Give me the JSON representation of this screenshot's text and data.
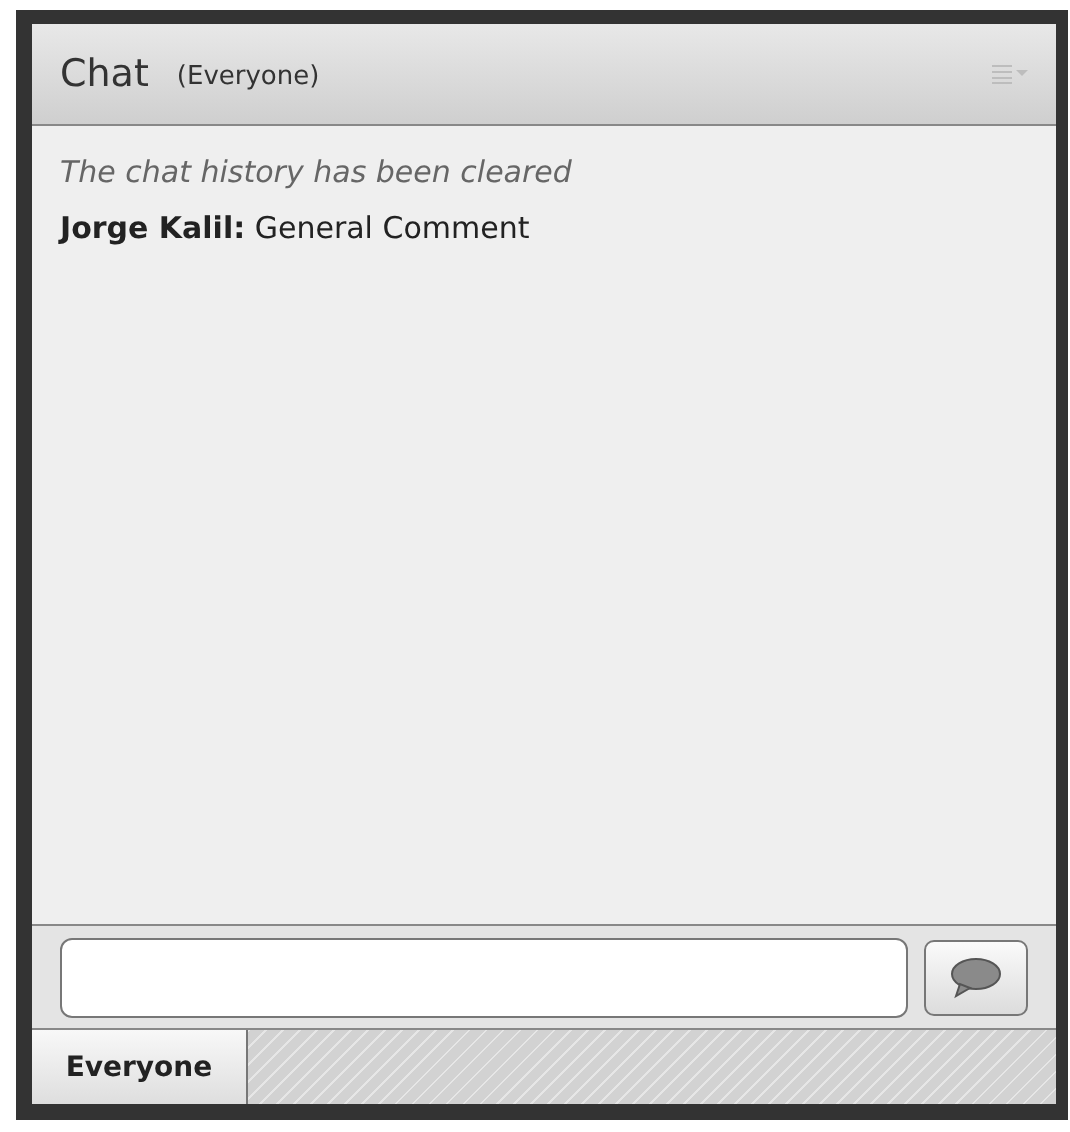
{
  "panel": {
    "title": "Chat",
    "scope": "(Everyone)"
  },
  "messages": [
    {
      "kind": "system",
      "text": "The chat history has been cleared"
    },
    {
      "kind": "message",
      "sender": "Jorge Kalil:",
      "text": "General Comment"
    }
  ],
  "tabs": [
    {
      "label": "Everyone",
      "selected": true
    }
  ]
}
